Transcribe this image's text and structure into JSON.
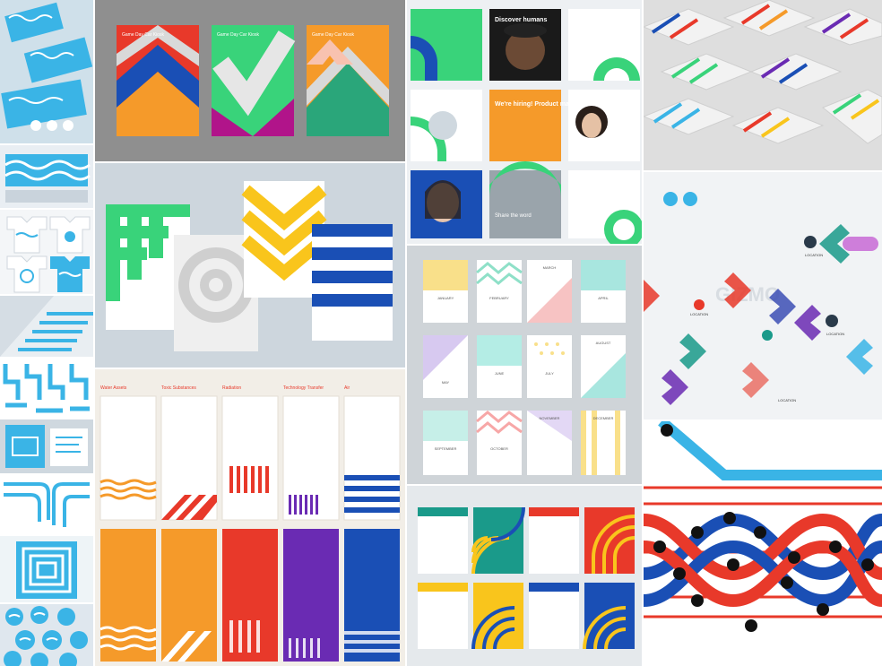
{
  "collage": {
    "colors": {
      "blue": "#1a4fb5",
      "cyan": "#3ab4e6",
      "red": "#e8392a",
      "orange": "#f59a2a",
      "yellow": "#f9c51c",
      "green": "#39d37a",
      "purple": "#6a2bb3",
      "gray": "#8a8a8a"
    },
    "poster_texts": {
      "poster_a_title": "Game Day Car Kiosk",
      "poster_b_title": "Game Day Car Kiosk",
      "poster_c_title": "Game Day Car Kiosk"
    },
    "card_texts": {
      "discover_humans": "Discover humans",
      "we_hiring": "We're hiring! Product manager",
      "share_word": "Share the word"
    },
    "calendar_months": [
      "JANUARY",
      "FEBRUARY",
      "MARCH",
      "APRIL",
      "MAY",
      "JUNE",
      "JULY",
      "AUGUST",
      "SEPTEMBER",
      "OCTOBER",
      "NOVEMBER",
      "DECEMBER"
    ],
    "signage": {
      "brand": "GIZMO",
      "labels": [
        "LOCATION",
        "LOCATION",
        "LOCATION",
        "LOCATION"
      ]
    },
    "report_headings": [
      "Water Assets",
      "Toxic Substances",
      "Radiation",
      "Technology Transfer",
      "Air"
    ]
  }
}
